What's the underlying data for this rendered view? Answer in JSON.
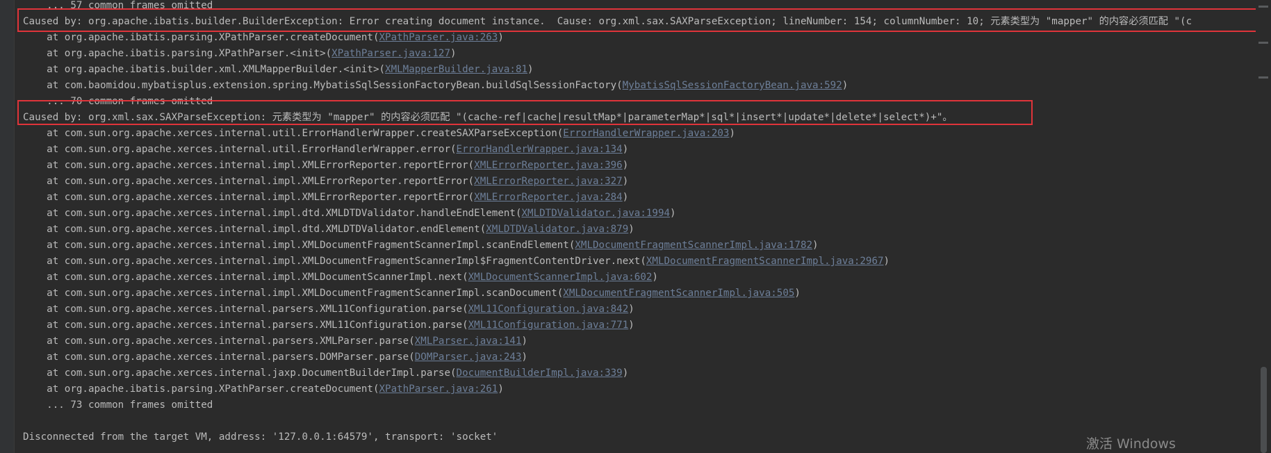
{
  "console": {
    "lines": [
      {
        "prefix": "    ... 57 common frames omitted",
        "link": "",
        "suffix": ""
      },
      {
        "prefix": "Caused by: org.apache.ibatis.builder.BuilderException: Error creating document instance.  Cause: org.xml.sax.SAXParseException; lineNumber: 154; columnNumber: 10; 元素类型为 \"mapper\" 的内容必须匹配 \"(c",
        "link": "",
        "suffix": ""
      },
      {
        "prefix": "    at org.apache.ibatis.parsing.XPathParser.createDocument(",
        "link": "XPathParser.java:263",
        "suffix": ")"
      },
      {
        "prefix": "    at org.apache.ibatis.parsing.XPathParser.<init>(",
        "link": "XPathParser.java:127",
        "suffix": ")"
      },
      {
        "prefix": "    at org.apache.ibatis.builder.xml.XMLMapperBuilder.<init>(",
        "link": "XMLMapperBuilder.java:81",
        "suffix": ")"
      },
      {
        "prefix": "    at com.baomidou.mybatisplus.extension.spring.MybatisSqlSessionFactoryBean.buildSqlSessionFactory(",
        "link": "MybatisSqlSessionFactoryBean.java:592",
        "suffix": ")"
      },
      {
        "prefix": "    ... 70 common frames omitted",
        "link": "",
        "suffix": ""
      },
      {
        "prefix": "Caused by: org.xml.sax.SAXParseException: 元素类型为 \"mapper\" 的内容必须匹配 \"(cache-ref|cache|resultMap*|parameterMap*|sql*|insert*|update*|delete*|select*)+\"。",
        "link": "",
        "suffix": ""
      },
      {
        "prefix": "    at com.sun.org.apache.xerces.internal.util.ErrorHandlerWrapper.createSAXParseException(",
        "link": "ErrorHandlerWrapper.java:203",
        "suffix": ")"
      },
      {
        "prefix": "    at com.sun.org.apache.xerces.internal.util.ErrorHandlerWrapper.error(",
        "link": "ErrorHandlerWrapper.java:134",
        "suffix": ")"
      },
      {
        "prefix": "    at com.sun.org.apache.xerces.internal.impl.XMLErrorReporter.reportError(",
        "link": "XMLErrorReporter.java:396",
        "suffix": ")"
      },
      {
        "prefix": "    at com.sun.org.apache.xerces.internal.impl.XMLErrorReporter.reportError(",
        "link": "XMLErrorReporter.java:327",
        "suffix": ")"
      },
      {
        "prefix": "    at com.sun.org.apache.xerces.internal.impl.XMLErrorReporter.reportError(",
        "link": "XMLErrorReporter.java:284",
        "suffix": ")"
      },
      {
        "prefix": "    at com.sun.org.apache.xerces.internal.impl.dtd.XMLDTDValidator.handleEndElement(",
        "link": "XMLDTDValidator.java:1994",
        "suffix": ")"
      },
      {
        "prefix": "    at com.sun.org.apache.xerces.internal.impl.dtd.XMLDTDValidator.endElement(",
        "link": "XMLDTDValidator.java:879",
        "suffix": ")"
      },
      {
        "prefix": "    at com.sun.org.apache.xerces.internal.impl.XMLDocumentFragmentScannerImpl.scanEndElement(",
        "link": "XMLDocumentFragmentScannerImpl.java:1782",
        "suffix": ")"
      },
      {
        "prefix": "    at com.sun.org.apache.xerces.internal.impl.XMLDocumentFragmentScannerImpl$FragmentContentDriver.next(",
        "link": "XMLDocumentFragmentScannerImpl.java:2967",
        "suffix": ")"
      },
      {
        "prefix": "    at com.sun.org.apache.xerces.internal.impl.XMLDocumentScannerImpl.next(",
        "link": "XMLDocumentScannerImpl.java:602",
        "suffix": ")"
      },
      {
        "prefix": "    at com.sun.org.apache.xerces.internal.impl.XMLDocumentFragmentScannerImpl.scanDocument(",
        "link": "XMLDocumentFragmentScannerImpl.java:505",
        "suffix": ")"
      },
      {
        "prefix": "    at com.sun.org.apache.xerces.internal.parsers.XML11Configuration.parse(",
        "link": "XML11Configuration.java:842",
        "suffix": ")"
      },
      {
        "prefix": "    at com.sun.org.apache.xerces.internal.parsers.XML11Configuration.parse(",
        "link": "XML11Configuration.java:771",
        "suffix": ")"
      },
      {
        "prefix": "    at com.sun.org.apache.xerces.internal.parsers.XMLParser.parse(",
        "link": "XMLParser.java:141",
        "suffix": ")"
      },
      {
        "prefix": "    at com.sun.org.apache.xerces.internal.parsers.DOMParser.parse(",
        "link": "DOMParser.java:243",
        "suffix": ")"
      },
      {
        "prefix": "    at com.sun.org.apache.xerces.internal.jaxp.DocumentBuilderImpl.parse(",
        "link": "DocumentBuilderImpl.java:339",
        "suffix": ")"
      },
      {
        "prefix": "    at org.apache.ibatis.parsing.XPathParser.createDocument(",
        "link": "XPathParser.java:261",
        "suffix": ")"
      },
      {
        "prefix": "    ... 73 common frames omitted",
        "link": "",
        "suffix": ""
      },
      {
        "prefix": "",
        "link": "",
        "suffix": ""
      },
      {
        "prefix": "Disconnected from the target VM, address: '127.0.0.1:64579', transport: 'socket'",
        "link": "",
        "suffix": ""
      }
    ]
  },
  "watermark": {
    "text": "激活 Windows"
  },
  "colors": {
    "background": "#2b2b2b",
    "text": "#bbbbbb",
    "link": "#6d7f99",
    "highlight_box": "#e0343a"
  }
}
